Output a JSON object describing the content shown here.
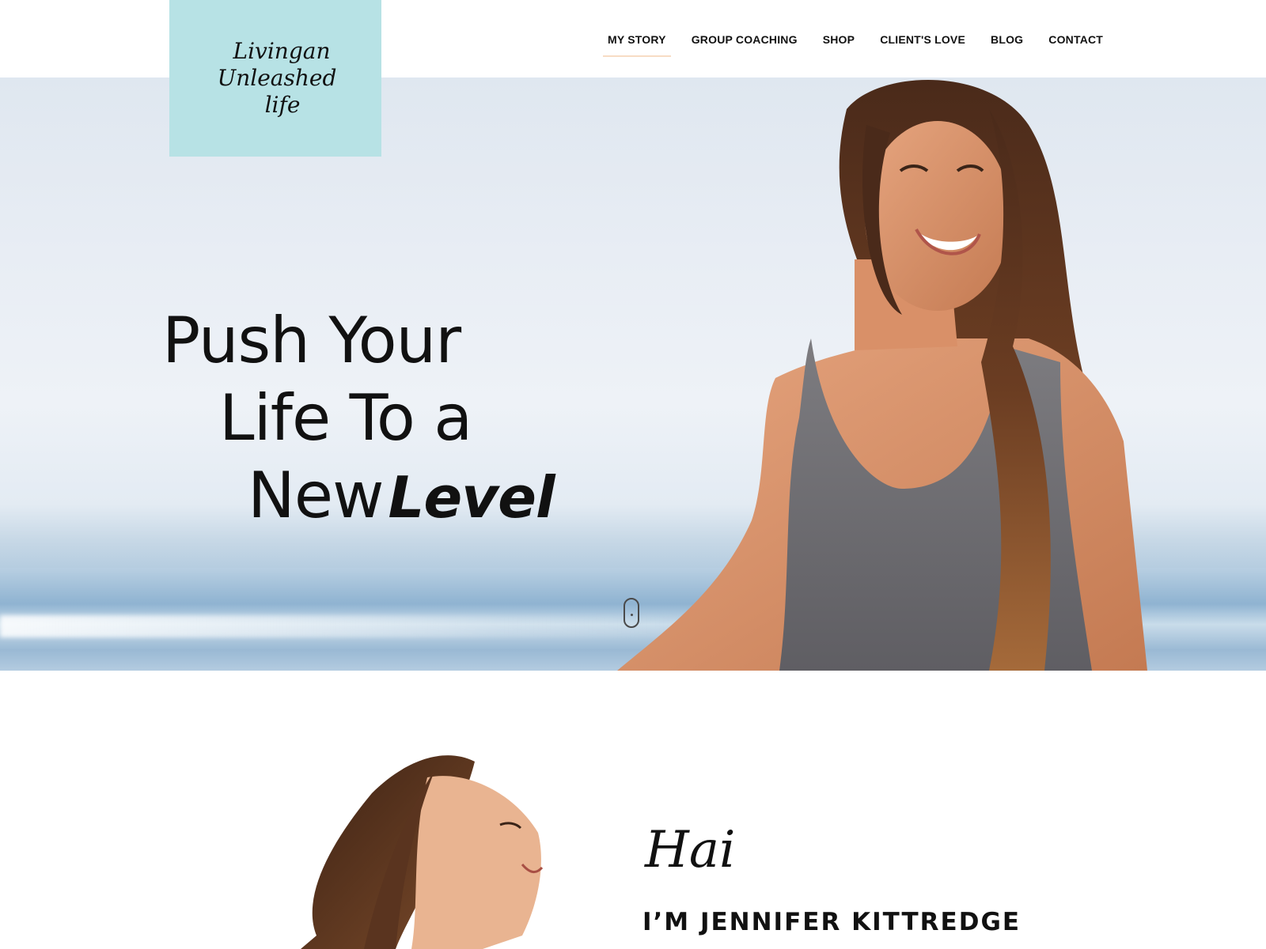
{
  "logo": {
    "line1": "Livingan",
    "line2": "Unleashed",
    "line3": "life",
    "background": "#b7e2e5"
  },
  "nav": {
    "items": [
      {
        "label": "MY STORY",
        "active": true
      },
      {
        "label": "GROUP COACHING",
        "active": false
      },
      {
        "label": "SHOP",
        "active": false
      },
      {
        "label": "CLIENT'S LOVE",
        "active": false
      },
      {
        "label": "BLOG",
        "active": false
      },
      {
        "label": "CONTACT",
        "active": false
      }
    ],
    "active_underline_color": "#f7dcc4"
  },
  "hero": {
    "title_line1": "Push Your",
    "title_line2": "Life To a",
    "title_line3": "New",
    "title_accent": "Level",
    "scroll_icon": "mouse-scroll-icon"
  },
  "about": {
    "greeting": "Hai",
    "name": "I’M  JENNIFER KITTREDGE"
  }
}
